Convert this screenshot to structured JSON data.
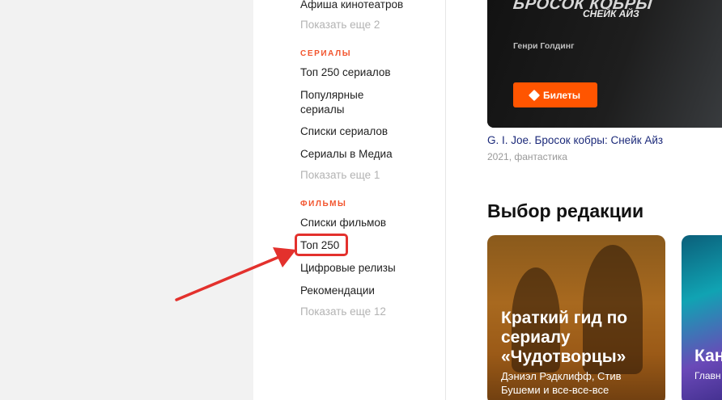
{
  "sidebar": {
    "top_items": [
      {
        "label": "Афиша кинотеатров"
      },
      {
        "label": "Показать еще 2"
      }
    ],
    "series_section": "СЕРИАЛЫ",
    "series_items": [
      {
        "label": "Топ 250 сериалов"
      },
      {
        "label": "Популярные сериалы"
      },
      {
        "label": "Списки сериалов"
      },
      {
        "label": "Сериалы в Медиа"
      },
      {
        "label": "Показать еще 1"
      }
    ],
    "films_section": "ФИЛЬМЫ",
    "films_items": [
      {
        "label": "Списки фильмов"
      },
      {
        "label": "Топ 250"
      },
      {
        "label": "Цифровые релизы"
      },
      {
        "label": "Рекомендации"
      },
      {
        "label": "Показать еще 12"
      }
    ]
  },
  "featured": {
    "poster_title": "БРОСОК КОБРЫ",
    "poster_subtitle": "СНЕЙК АЙЗ",
    "actor": "Генри Голдинг",
    "ticket_button": "Билеты",
    "movie_title": "G. I. Joe. Бросок кобры: Снейк Айз",
    "movie_meta": "2021, фантастика"
  },
  "editors_choice": {
    "heading": "Выбор редакции",
    "cards": [
      {
        "title": "Краткий гид по сериалу «Чудотворцы»",
        "description": "Дэниэл Рэдклифф, Стив Бушеми и все-все-все"
      },
      {
        "title": "Кан",
        "description": "Главн с фес"
      }
    ]
  },
  "colors": {
    "accent": "#ff5500",
    "section_label": "#f2542d",
    "annotation": "#e3312d",
    "link": "#1c2a7a"
  }
}
